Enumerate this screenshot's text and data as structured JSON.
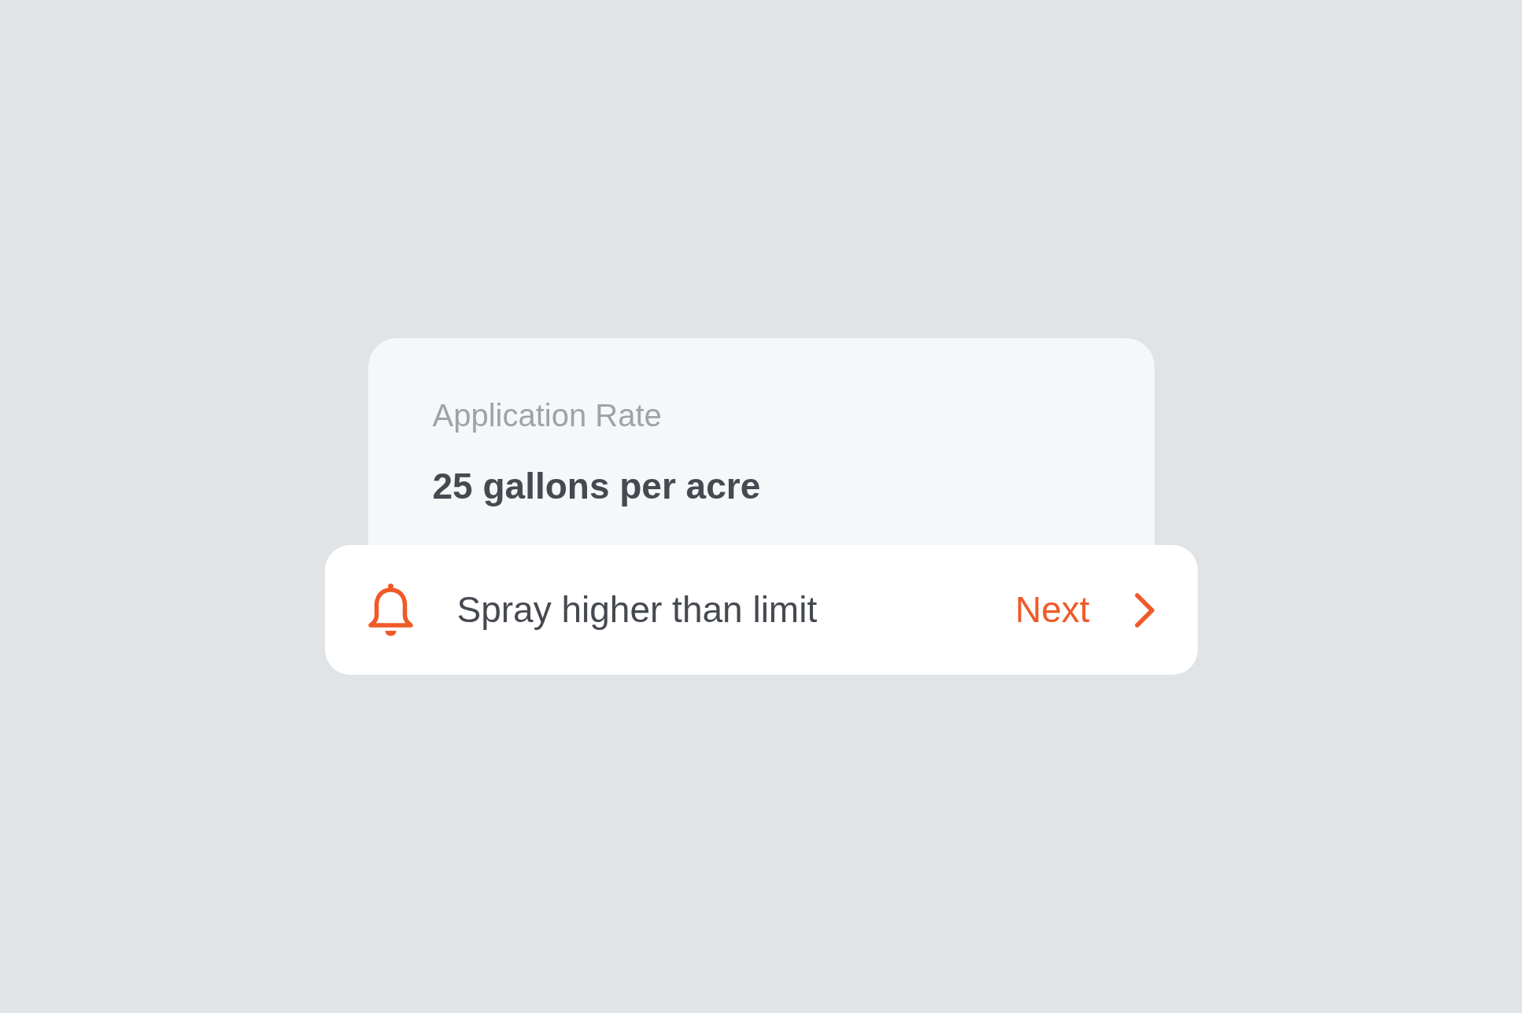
{
  "field_card": {
    "label": "Application Rate",
    "value": "25 gallons per acre"
  },
  "alert": {
    "message": "Spray higher than limit",
    "action": "Next"
  }
}
